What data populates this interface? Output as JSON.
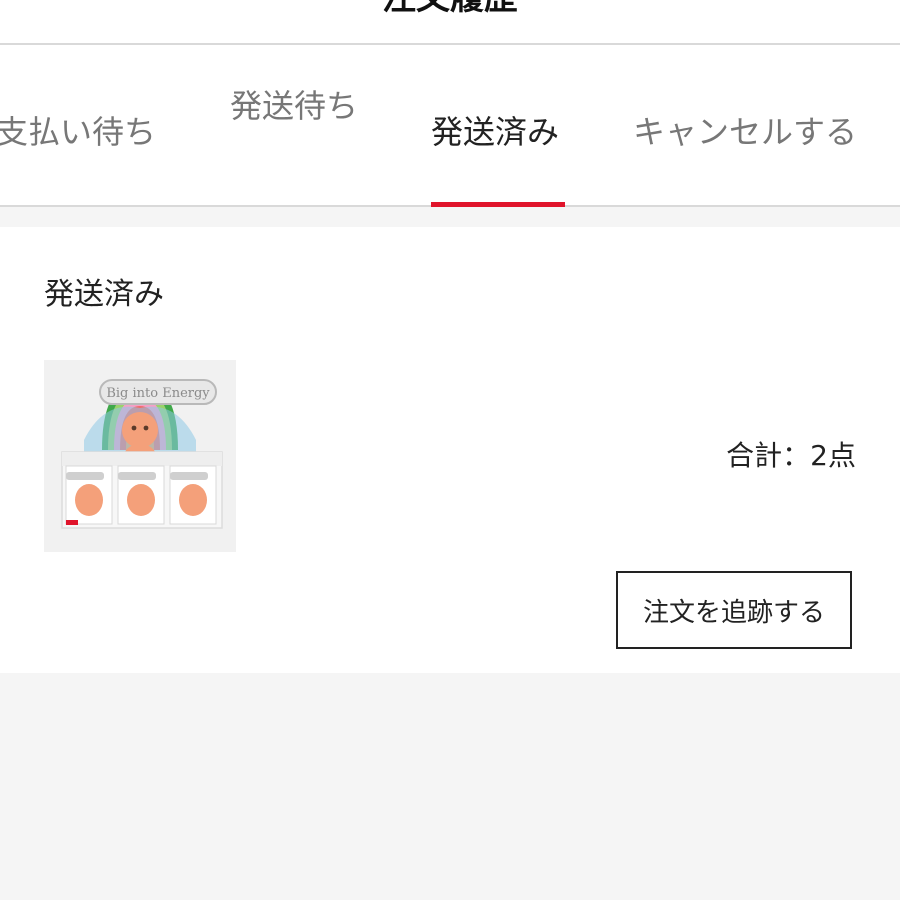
{
  "header": {
    "title": "注文履歴"
  },
  "tabs": [
    {
      "label": "支払い待ち",
      "active": false
    },
    {
      "label": "発送待ち",
      "active": false
    },
    {
      "label": "発送済み",
      "active": true
    },
    {
      "label": "キャンセルする",
      "active": false
    }
  ],
  "order": {
    "status": "発送済み",
    "product_image": "blind-box-figure-product",
    "product_box_text": "Big into Energy",
    "total_label": "合計：2点",
    "track_button_label": "注文を追跡する"
  },
  "colors": {
    "accent": "#e0142b",
    "background": "#f5f5f5",
    "card": "#ffffff"
  }
}
